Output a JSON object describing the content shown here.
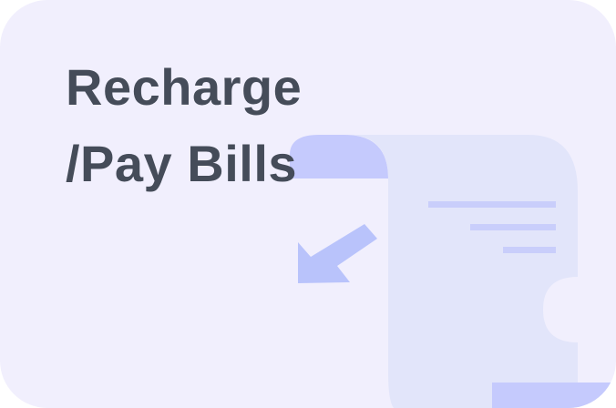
{
  "card": {
    "title_line1": "Recharge",
    "title_line2": "/Pay Bills",
    "icon": "bill-receipt-icon",
    "colors": {
      "background": "#f1effd",
      "title": "#454c59",
      "receipt_dark": "#c5cafd",
      "receipt_light": "#e2e5fa",
      "receipt_lines": "#c9cefb",
      "arrow": "#b9c3fb"
    }
  }
}
